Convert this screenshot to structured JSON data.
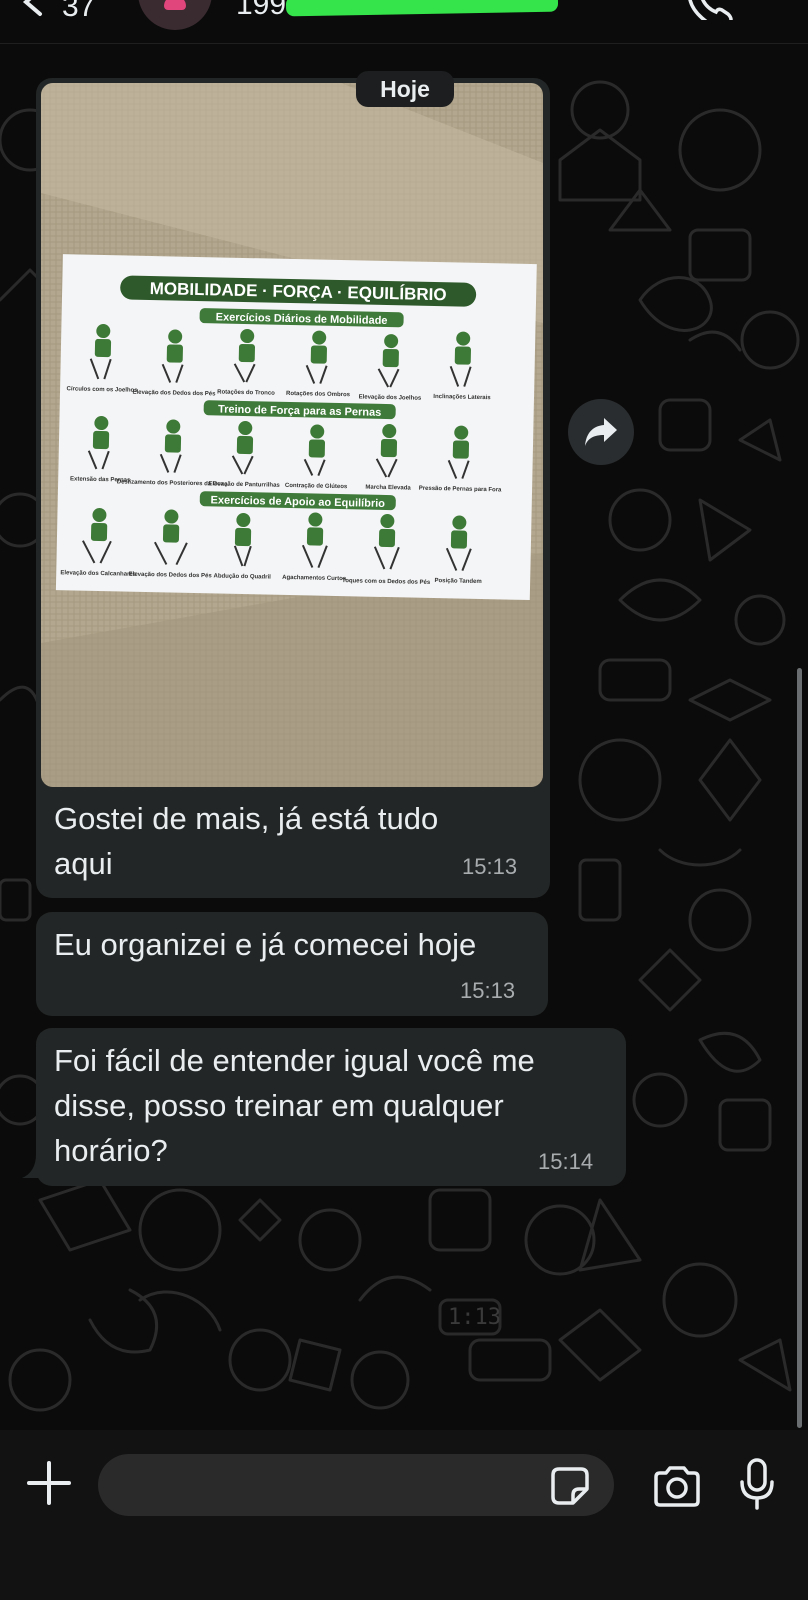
{
  "header": {
    "unread_count": "37",
    "contact_name_visible": "199",
    "icons": [
      "back-chevron-icon",
      "avatar",
      "phone-call-icon"
    ]
  },
  "chat": {
    "date_separator": "Hoje",
    "messages": [
      {
        "type": "image",
        "poster": {
          "title": "MOBILIDADE · FORÇA · EQUILÍBRIO",
          "sections": [
            {
              "heading": "Exercícios Diários de Mobilidade",
              "captions": [
                "Círculos com os Joelhos",
                "Elevação dos Dedos dos Pés",
                "Rotações do Tronco",
                "Rotações dos Ombros",
                "Elevação dos Joelhos",
                "Inclinações Laterais"
              ]
            },
            {
              "heading": "Treino de Força para as Pernas",
              "captions": [
                "Extensão das Pernas",
                "Deslizamento dos Posteriores da Coxa",
                "Elevação de Panturrilhas",
                "Contração de Glúteos",
                "Marcha Elevada",
                "Pressão de Pernas para Fora"
              ]
            },
            {
              "heading": "Exercícios de Apoio ao Equilíbrio",
              "captions": [
                "Elevação dos Calcanhares",
                "Elevação dos Dedos dos Pés",
                "Abdução do Quadril",
                "Agachamentos Curtos",
                "Toques com os Dedos dos Pés",
                "Posição Tandem"
              ]
            }
          ]
        },
        "text_line1": "Gostei de mais, já está tudo",
        "text_line2": "aqui",
        "time": "15:13"
      },
      {
        "type": "text",
        "text_line1": "Eu organizei e já comecei hoje",
        "time": "15:13"
      },
      {
        "type": "text",
        "text_line1": "Foi fácil de entender igual você me",
        "text_line2": "disse, posso treinar em qualquer",
        "text_line3": "horário?",
        "time": "15:14"
      }
    ]
  },
  "wallpaper_clock": "1:13",
  "composer": {
    "placeholder": "",
    "icons": [
      "plus-icon",
      "sticker-icon",
      "camera-icon",
      "microphone-icon"
    ]
  },
  "colors": {
    "background": "#0b0b0b",
    "bubble": "#232626",
    "poster_green": "#2e5a2b",
    "redaction": "#35e34a"
  }
}
